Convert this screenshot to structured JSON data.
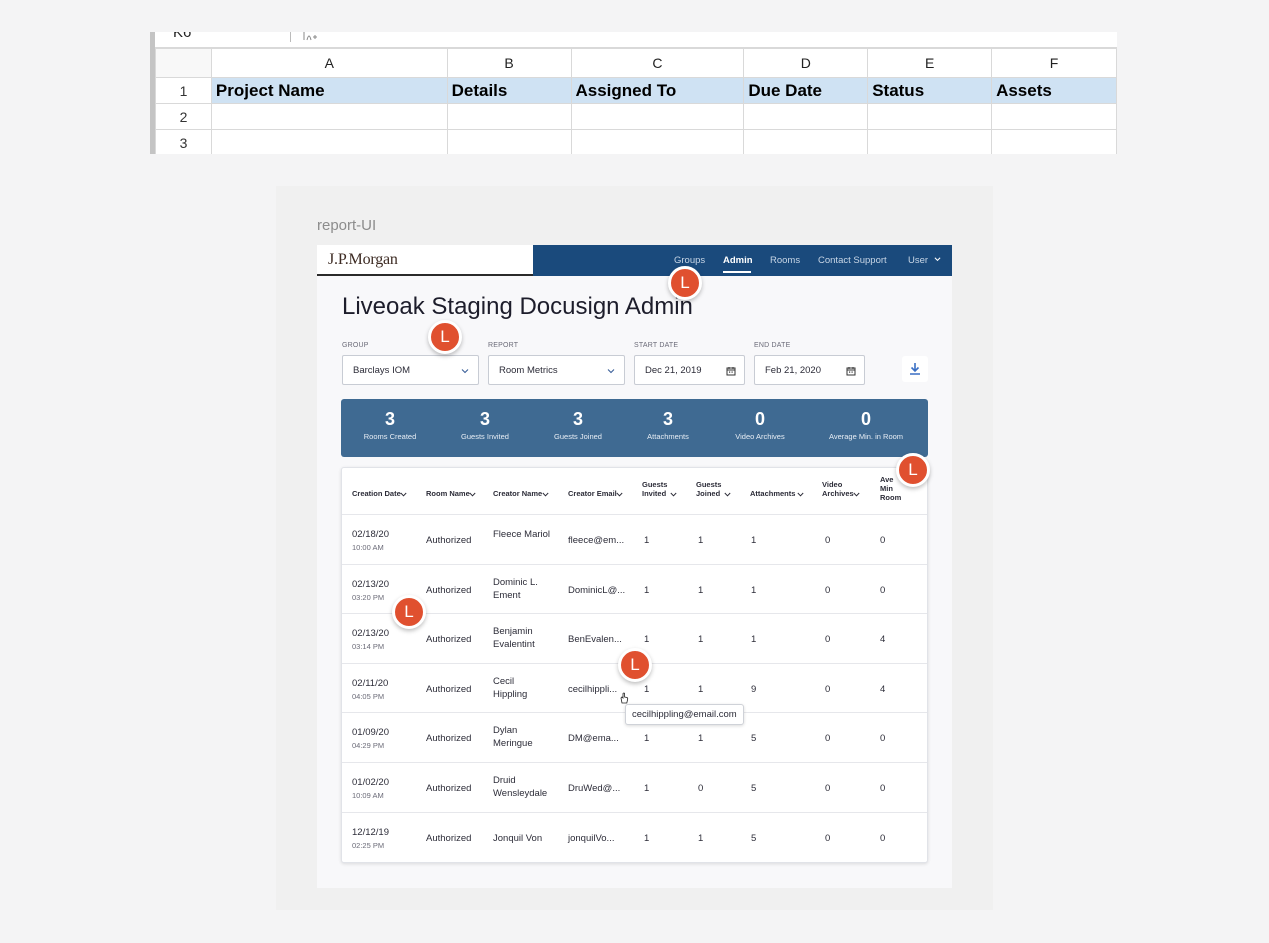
{
  "spreadsheet": {
    "cell_ref": "K6",
    "columns": [
      "A",
      "B",
      "C",
      "D",
      "E",
      "F"
    ],
    "row_numbers": [
      "1",
      "2",
      "3"
    ],
    "headers": [
      "Project Name",
      "Details",
      "Assigned To",
      "Due Date",
      "Status",
      "Assets"
    ],
    "header_fill": "#cfe2f3"
  },
  "frame": {
    "label": "report-UI"
  },
  "nav": {
    "brand": "J.P.Morgan",
    "items": [
      "Groups",
      "Admin",
      "Rooms",
      "Contact Support",
      "User"
    ],
    "active": "Admin",
    "color": "#1a4a7c"
  },
  "page": {
    "title": "Liveoak Staging Docusign Admin"
  },
  "filters": {
    "group": {
      "label": "GROUP",
      "value": "Barclays IOM"
    },
    "report": {
      "label": "REPORT",
      "value": "Room Metrics"
    },
    "start": {
      "label": "START DATE",
      "value": "Dec 21, 2019"
    },
    "end": {
      "label": "END DATE",
      "value": "Feb 21, 2020"
    }
  },
  "stats": [
    {
      "value": "3",
      "label": "Rooms Created"
    },
    {
      "value": "3",
      "label": "Guests Invited"
    },
    {
      "value": "3",
      "label": "Guests Joined"
    },
    {
      "value": "3",
      "label": "Attachments"
    },
    {
      "value": "0",
      "label": "Video Archives"
    },
    {
      "value": "0",
      "label": "Average Min. in Room"
    }
  ],
  "table": {
    "columns": [
      [
        "Creation Date"
      ],
      [
        "Room Name"
      ],
      [
        "Creator Name"
      ],
      [
        "Creator Email"
      ],
      [
        "Guests",
        "Invited"
      ],
      [
        "Guests",
        "Joined"
      ],
      [
        "Attachments"
      ],
      [
        "Video",
        "Archives"
      ],
      [
        "Ave",
        "Min",
        "Room"
      ]
    ],
    "rows": [
      {
        "date": "02/18/20",
        "time": "10:00 AM",
        "room": "Authorized",
        "name": [
          "Fleece Mariol"
        ],
        "email": "fleece@em...",
        "invited": "1",
        "joined": "1",
        "attachments": "1",
        "archives": "0",
        "avg": "0"
      },
      {
        "date": "02/13/20",
        "time": "03:20 PM",
        "room": "Authorized",
        "name": [
          "Dominic L.",
          "Ement"
        ],
        "email": "DominicL@...",
        "invited": "1",
        "joined": "1",
        "attachments": "1",
        "archives": "0",
        "avg": "0"
      },
      {
        "date": "02/13/20",
        "time": "03:14 PM",
        "room": "Authorized",
        "name": [
          "Benjamin",
          "Evalentint"
        ],
        "email": "BenEvalen...",
        "invited": "1",
        "joined": "1",
        "attachments": "1",
        "archives": "0",
        "avg": "4"
      },
      {
        "date": "02/11/20",
        "time": "04:05 PM",
        "room": "Authorized",
        "name": [
          "Cecil",
          "Hippling"
        ],
        "email": "cecilhippli...",
        "invited": "1",
        "joined": "1",
        "attachments": "9",
        "archives": "0",
        "avg": "4"
      },
      {
        "date": "01/09/20",
        "time": "04:29 PM",
        "room": "Authorized",
        "name": [
          "Dylan",
          "Meringue"
        ],
        "email": "DM@ema...",
        "invited": "1",
        "joined": "1",
        "attachments": "5",
        "archives": "0",
        "avg": "0"
      },
      {
        "date": "01/02/20",
        "time": "10:09 AM",
        "room": "Authorized",
        "name": [
          "Druid",
          "Wensleydale"
        ],
        "email": "DruWed@...",
        "invited": "1",
        "joined": "0",
        "attachments": "5",
        "archives": "0",
        "avg": "0"
      },
      {
        "date": "12/12/19",
        "time": "02:25 PM",
        "room": "Authorized",
        "name": [
          "Jonquil Von"
        ],
        "email": "jonquilVo...",
        "invited": "1",
        "joined": "1",
        "attachments": "5",
        "archives": "0",
        "avg": "0"
      }
    ]
  },
  "tooltip": "cecilhippling@email.com",
  "avatars": {
    "initial": "L",
    "color": "#e0502f",
    "count": 5
  }
}
